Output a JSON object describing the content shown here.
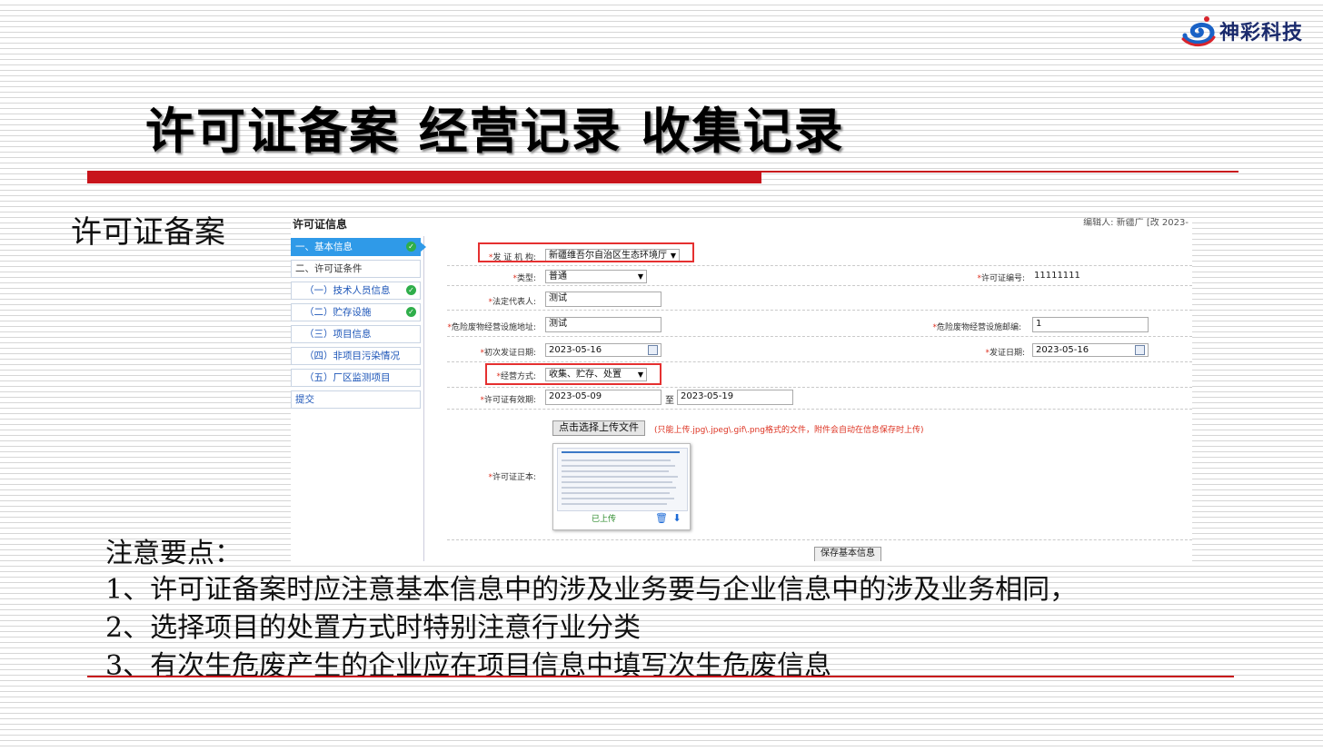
{
  "brand": {
    "name": "神彩科技"
  },
  "slide": {
    "title": "许可证备案 经营记录 收集记录",
    "section": "许可证备案"
  },
  "screenshot": {
    "header_title": "许可证信息",
    "header_meta": "编辑人: 新疆广 [改 2023-",
    "nav": [
      {
        "label": "一、基本信息",
        "checked": true,
        "active": true
      },
      {
        "label": "二、许可证条件",
        "checked": false
      },
      {
        "label": "（一）技术人员信息",
        "checked": true
      },
      {
        "label": "（二）贮存设施",
        "checked": true
      },
      {
        "label": "（三）项目信息",
        "checked": false
      },
      {
        "label": "（四）非项目污染情况",
        "checked": false
      },
      {
        "label": "（五）厂区监测项目",
        "checked": false
      },
      {
        "label": "提交",
        "checked": false
      }
    ],
    "form": {
      "issuer_label": "发 证 机 构:",
      "issuer_value": "新疆维吾尔自治区生态环境厅",
      "type_label": "类型:",
      "type_value": "普通",
      "license_no_label": "许可证编号:",
      "license_no_value": "11111111",
      "legal_rep_label": "法定代表人:",
      "legal_rep_value": "测试",
      "facility_addr_label": "危险废物经营设施地址:",
      "facility_addr_value": "测试",
      "facility_zip_label": "危险废物经营设施邮编:",
      "facility_zip_value": "1",
      "first_issue_label": "初次发证日期:",
      "first_issue_value": "2023-05-16",
      "issue_date_label": "发证日期:",
      "issue_date_value": "2023-05-16",
      "mode_label": "经营方式:",
      "mode_value": "收集、贮存、处置",
      "validity_label": "许可证有效期:",
      "validity_from": "2023-05-09",
      "validity_to_sep": "至",
      "validity_to": "2023-05-19",
      "upload_button": "点击选择上传文件",
      "upload_note": "(只能上传.jpg\\.jpeg\\.gif\\.png格式的文件，附件会自动在信息保存时上传)",
      "copy_label": "许可证正本:",
      "uploaded_status": "已上传",
      "save_button": "保存基本信息"
    }
  },
  "notes": {
    "heading": "注意要点：",
    "items": [
      "1、许可证备案时应注意基本信息中的涉及业务要与企业信息中的涉及业务相同，",
      "2、选择项目的处置方式时特别注意行业分类",
      "3、有次生危废产生的企业应在项目信息中填写次生危废信息"
    ]
  },
  "colors": {
    "accent_red": "#c8141b",
    "nav_active": "#2f9ae8",
    "brand_blue": "#1a2a6c"
  }
}
